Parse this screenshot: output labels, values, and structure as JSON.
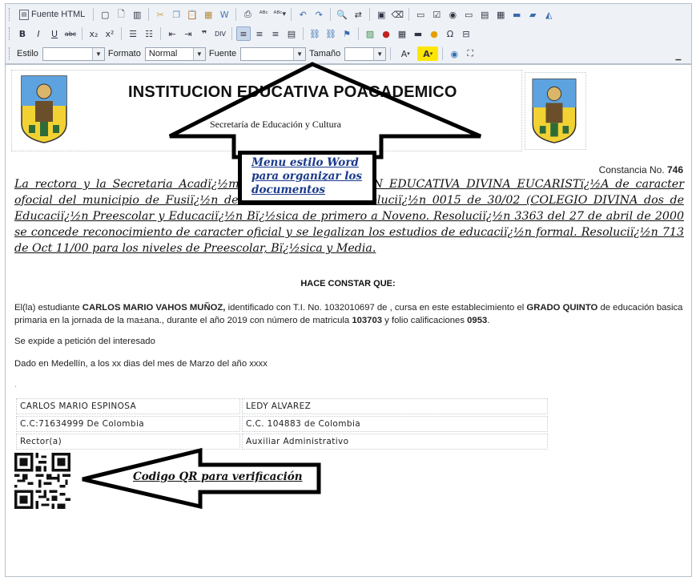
{
  "toolbar": {
    "source_html_label": "Fuente HTML",
    "style_label": "Estilo",
    "style_value": "",
    "format_label": "Formato",
    "format_value": "Normal",
    "font_label": "Fuente",
    "font_value": "",
    "size_label": "Tamaño",
    "size_value": "",
    "row1_icons": [
      "new-page-icon",
      "preview-icon",
      "templates-icon",
      "cut-icon",
      "copy-icon",
      "paste-icon",
      "paste-text-icon",
      "paste-word-icon",
      "print-icon",
      "spellcheck-icon",
      "spellcheck-as-you-type-icon",
      "undo-icon",
      "redo-icon",
      "find-icon",
      "replace-icon",
      "select-all-icon",
      "remove-format-icon",
      "form-icon",
      "checkbox-icon",
      "radio-icon",
      "textfield-icon",
      "textarea-icon",
      "select-field-icon",
      "button-icon",
      "image-button-icon",
      "hidden-field-icon"
    ],
    "row2_icons": [
      "bold-icon",
      "italic-icon",
      "underline-icon",
      "strike-icon",
      "subscript-icon",
      "superscript-icon",
      "numbered-list-icon",
      "bulleted-list-icon",
      "outdent-icon",
      "indent-icon",
      "blockquote-icon",
      "div-icon",
      "align-left-icon",
      "align-center-icon",
      "align-right-icon",
      "justify-icon",
      "link-icon",
      "unlink-icon",
      "anchor-icon",
      "image-icon",
      "flash-icon",
      "table-icon",
      "horizontal-rule-icon",
      "smiley-icon",
      "special-char-icon",
      "page-break-icon"
    ],
    "row2_glyphs": [
      "B",
      "I",
      "U",
      "abc",
      "x₂",
      "x²"
    ]
  },
  "document": {
    "institution_title": "INSTITUCION EDUCATIVA POACADEMICO",
    "subtitle": "Secretaría de Educación y Cultura",
    "certificate_label": "Constancia No.",
    "certificate_number": "746",
    "intro_text": "La rectora y la Secretaria Acadï¿½mica de la INSTITUCIÓN EDUCATIVA DIVINA EUCARISTï¿½A de caracter ofocial del municipio de Fusiï¿½n de Establecimientos Resoluciï¿½n 0015 de 30/02 (COLEGIO DIVINA dos de Educaciï¿½n Preescolar y Educaciï¿½n Bï¿½sica de primero a Noveno. Resoluciï¿½n 3363 del 27 de abril de 2000 se concede reconocimiento de caracter oficial y se legalizan los estudios de educaciï¿½n formal. Resoluciï¿½n 713 de Oct 11/00 para los niveles de Preescolar, Bï¿½sica y Media.",
    "certifies_heading": "HACE CONSTAR QUE:",
    "student_prefix": "El(la) estudiante ",
    "student_name": "CARLOS MARIO VAHOS MUÑOZ,",
    "student_mid": " identificado con T.I. No. 1032010697 de , cursa en este establecimiento el ",
    "grade": "GRADO QUINTO",
    "student_mid2": " de educación basica primaria en la jornada de la ma±ana., durante el año 2019 con número de matricula ",
    "enrollment_number": "103703",
    "student_mid3": " y folio calificaciones ",
    "folio_number": "0953",
    "student_end": ".",
    "issued_at_request": "Se expide a petición del interesado",
    "given_in": "Dado en Medellín, a los xx dias del mes de Marzo del año xxxx",
    "dot_line": ".",
    "signatures": [
      [
        "CARLOS MARIO ESPINOSA",
        "LEDY ALVAREZ"
      ],
      [
        "C.C:71634999 De Colombia",
        "C.C. 104883 de Colombia"
      ],
      [
        "Rector(a)",
        "Auxiliar Administrativo"
      ]
    ]
  },
  "annotations": {
    "menu_note": "Menu estilo Word para organizar los documentos",
    "qr_note": "Codigo QR para verificación"
  }
}
